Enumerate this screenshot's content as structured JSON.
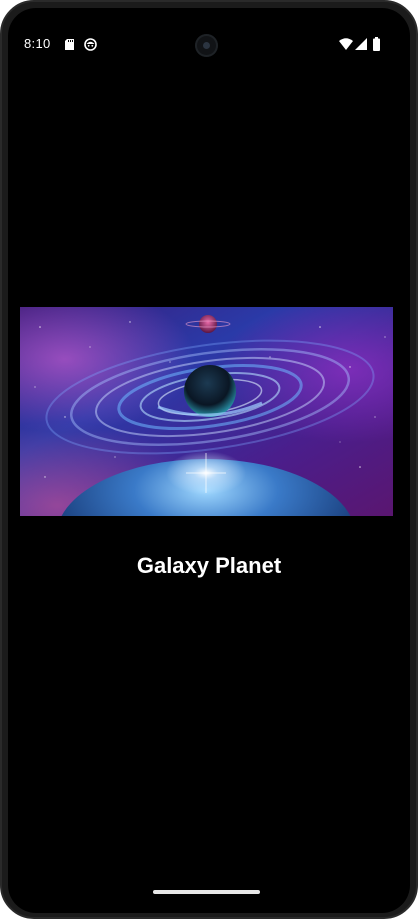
{
  "status_bar": {
    "time": "8:10",
    "icons": [
      "sd-card-icon",
      "face-icon",
      "camera-icon",
      "wifi-icon",
      "cell-signal-icon",
      "battery-icon"
    ]
  },
  "content": {
    "image": "galaxy-planet-image",
    "title": "Galaxy Planet"
  },
  "colors": {
    "background": "#000000",
    "text": "#ffffff",
    "device_frame": "#1b1b1b"
  }
}
